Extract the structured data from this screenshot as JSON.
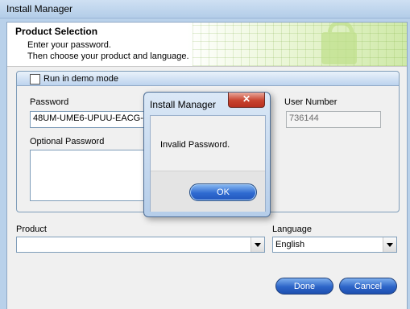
{
  "window": {
    "title": "Install Manager"
  },
  "banner": {
    "title": "Product Selection",
    "line1": "Enter your password.",
    "line2": "Then choose your product and language."
  },
  "demo": {
    "label": "Run in demo mode",
    "checked": false
  },
  "password": {
    "label": "Password",
    "value": "48UM-UME6-UPUU-EACG-J6"
  },
  "user_number": {
    "label": "User Number",
    "value": "736144"
  },
  "optional_password": {
    "label": "Optional Password",
    "value": ""
  },
  "product": {
    "label": "Product",
    "value": ""
  },
  "language": {
    "label": "Language",
    "value": "English"
  },
  "buttons": {
    "done": "Done",
    "cancel": "Cancel"
  },
  "dialog": {
    "title": "Install Manager",
    "message": "Invalid Password.",
    "ok": "OK"
  },
  "icons": {
    "close": "close-icon",
    "dropdown": "chevron-down-icon",
    "checkbox": "checkbox-icon"
  }
}
